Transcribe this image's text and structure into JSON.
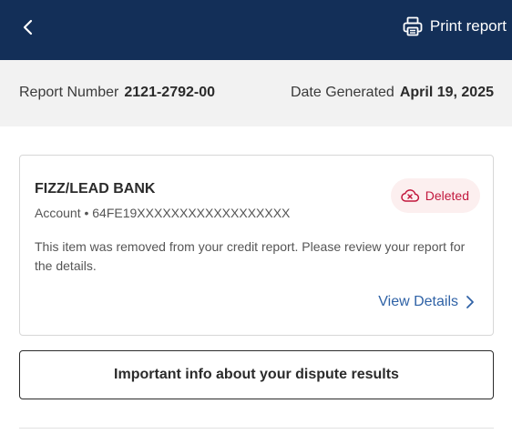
{
  "header": {
    "back_icon": "chevron-left-icon",
    "print_icon": "printer-icon",
    "print_label": "Print report",
    "background_color": "#132f58"
  },
  "report_meta": {
    "report_number_label": "Report Number",
    "report_number_value": "2121-2792-00",
    "date_label": "Date Generated",
    "date_value": "April 19, 2025"
  },
  "item_card": {
    "creditor": "FIZZ/LEAD BANK",
    "account": "Account • 64FE19XXXXXXXXXXXXXXXXXX",
    "status_icon": "cloud-x-icon",
    "status": "Deleted",
    "status_color": "#c2183d",
    "description": "This item was removed from your credit report. Please review your report for the details.",
    "view_details_label": "View Details",
    "view_details_icon": "chevron-right-icon",
    "link_color": "#2f62a6"
  },
  "dispute_button": {
    "label": "Important info about your dispute results"
  }
}
